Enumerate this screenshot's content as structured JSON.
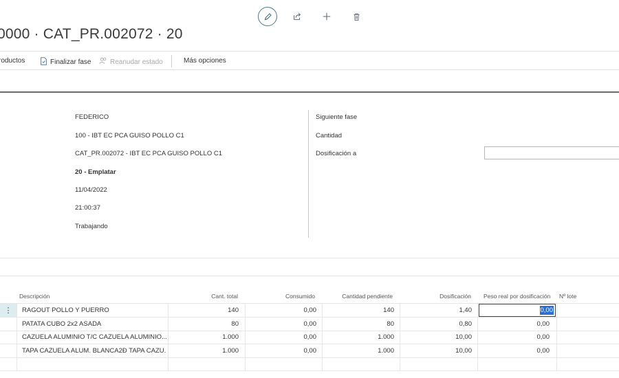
{
  "header": {
    "title": "0000 · CAT_PR.002072 · 20",
    "actions": [
      "edit-icon",
      "share-icon",
      "plus-icon",
      "trash-icon"
    ]
  },
  "toolbar": {
    "productos": "roductos",
    "finalizar": "Finalizar fase",
    "reanudar": "Reanudar estado",
    "mas": "Más opciones"
  },
  "details": {
    "left_values": [
      "FEDERICO",
      "100 - IBT EC PCA GUISO POLLO C1",
      "CAT_PR.002072 - IBT EC PCA GUISO POLLO C1",
      "20 - Emplatar",
      "11/04/2022",
      "21:00:37",
      "Trabajando"
    ],
    "right_labels": [
      "Siguiente fase",
      "Cantidad",
      "Dosificación a"
    ],
    "dosificacion_value": ""
  },
  "grid": {
    "columns": [
      "Descripción",
      "Cant. total",
      "Consumido",
      "Cantidad pendiente",
      "Dosificación",
      "Peso real por dosificación",
      "Nº lote"
    ],
    "rows": [
      {
        "desc": "RAGOUT POLLO Y PUERRO",
        "total": "140",
        "consumido": "0,00",
        "pendiente": "140",
        "dosif": "1,40",
        "peso": "0,00",
        "lote": ""
      },
      {
        "desc": "PATATA CUBO 2x2 ASADA",
        "total": "80",
        "consumido": "0,00",
        "pendiente": "80",
        "dosif": "0,80",
        "peso": "0,00",
        "lote": ""
      },
      {
        "desc": "CAZUELA ALUMINIO T/C  CAZUELA ALUMINIO...",
        "total": "1.000",
        "consumido": "0,00",
        "pendiente": "1.000",
        "dosif": "10,00",
        "peso": "0,00",
        "lote": ""
      },
      {
        "desc": "TAPA CAZUELA ALUM. BLANCA2Ð  TAPA CAZU...",
        "total": "1.000",
        "consumido": "0,00",
        "pendiente": "1.000",
        "dosif": "10,00",
        "peso": "0,00",
        "lote": ""
      }
    ],
    "row_menu": "⋮"
  }
}
